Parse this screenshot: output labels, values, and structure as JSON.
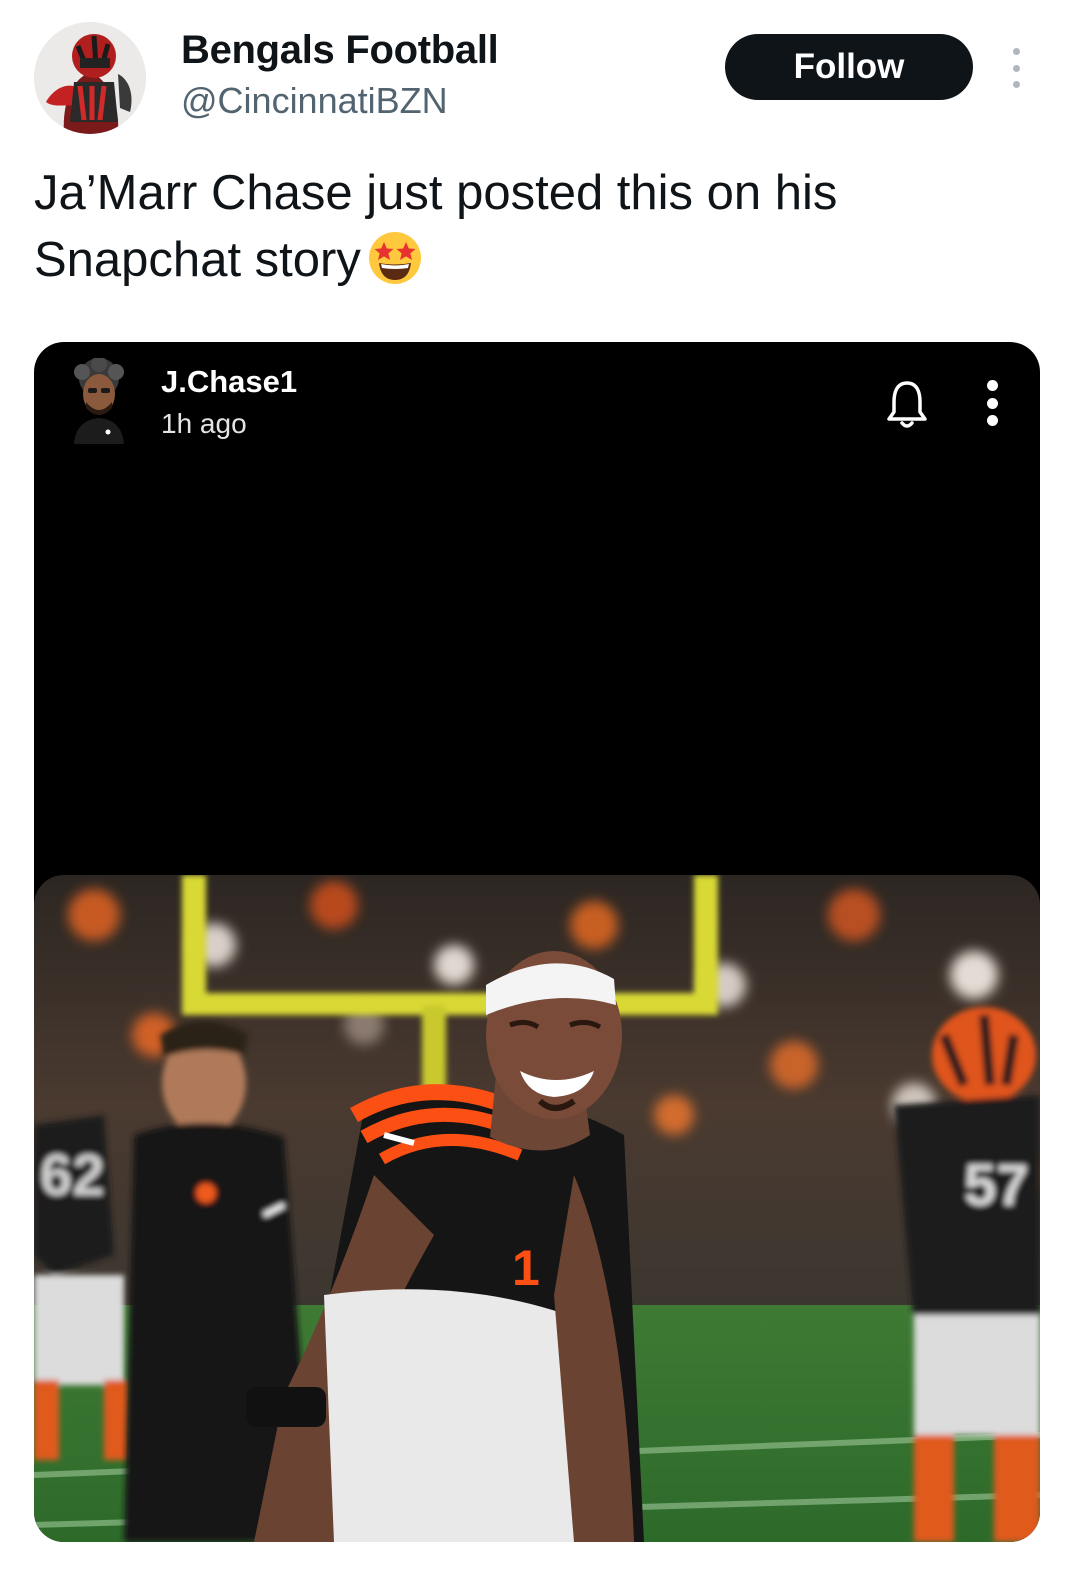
{
  "tweet": {
    "author": {
      "name": "Bengals Football",
      "handle": "@CincinnatiBZN"
    },
    "follow_label": "Follow",
    "text_lines": [
      "Ja’Marr Chase just posted this on his",
      "Snapchat story"
    ],
    "emoji": "star-struck-emoji"
  },
  "snap": {
    "username": "J.Chase1",
    "time": "1h ago"
  },
  "photo": {
    "subject": "football-player-photo"
  },
  "colors": {
    "follow_bg": "#0f1419",
    "text_primary": "#0f1419",
    "text_secondary": "#536471",
    "jersey_orange": "#fb4f14",
    "goalpost_yellow": "#d9d936"
  }
}
